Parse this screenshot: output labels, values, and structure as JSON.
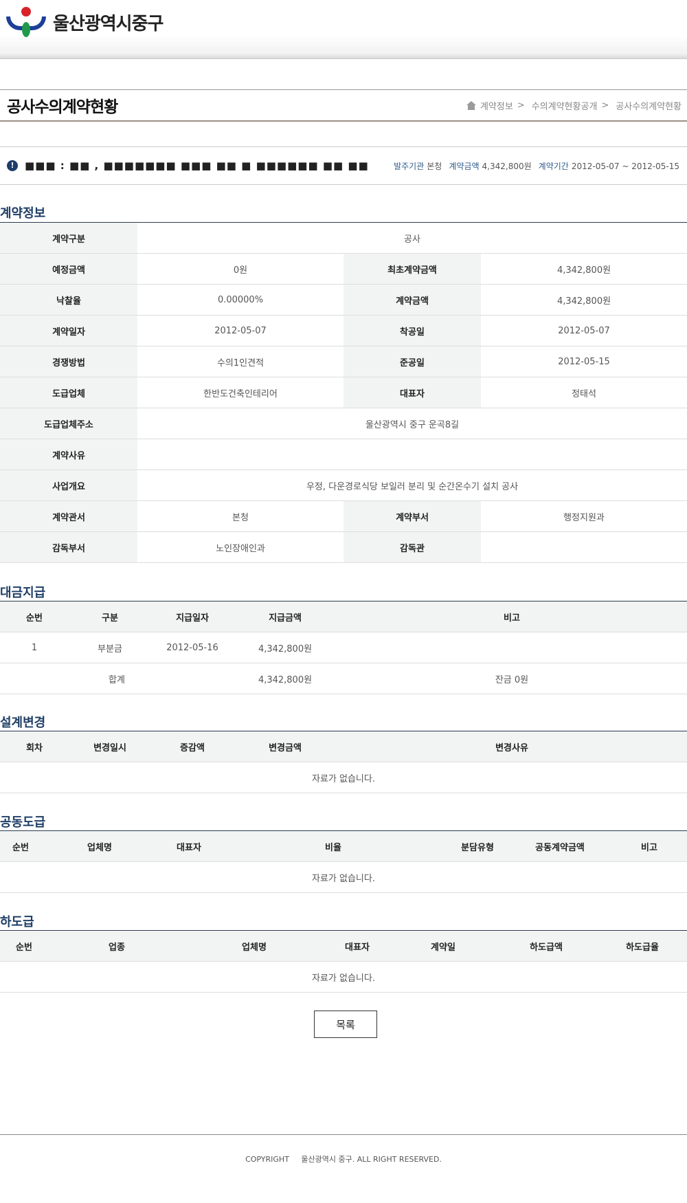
{
  "header": {
    "logo_text": "울산광역시중구"
  },
  "page": {
    "title": "공사수의계약현황",
    "breadcrumb": [
      "계약정보",
      "수의계약현황공개",
      "공사수의계약현황"
    ]
  },
  "summary": {
    "name": "■■■ : ■■ , ■■■■■■■ ■■■ ■■ ■ ■■■■■■ ■■ ■■",
    "agency_label": "발주기관",
    "agency": "본청",
    "amount_label": "계약금액",
    "amount": "4,342,800원",
    "period_label": "계약기간",
    "period": "2012-05-07 ~ 2012-05-15"
  },
  "contract": {
    "section_title": "계약정보",
    "type_label": "계약구분",
    "type": "공사",
    "estimate_label": "예정금액",
    "estimate": "0원",
    "initial_amount_label": "최초계약금액",
    "initial_amount": "4,342,800원",
    "rate_label": "낙찰율",
    "rate": "0.00000%",
    "amount_label": "계약금액",
    "amount": "4,342,800원",
    "date_label": "계약일자",
    "date": "2012-05-07",
    "start_label": "착공일",
    "start": "2012-05-07",
    "method_label": "경쟁방법",
    "method": "수의1인견적",
    "end_label": "준공일",
    "end": "2012-05-15",
    "company_label": "도급업체",
    "company": "한반도건축인테리어",
    "ceo_label": "대표자",
    "ceo": "정태석",
    "address_label": "도급업체주소",
    "address": "울산광역시 중구 운곡8길",
    "reason_label": "계약사유",
    "reason": "",
    "overview_label": "사업개요",
    "overview": "우정, 다운경로식당 보일러 분리 및 순간온수기 설치 공사",
    "office_label": "계약관서",
    "office": "본청",
    "dept_label": "계약부서",
    "dept": "행정지원과",
    "supervise_dept_label": "감독부서",
    "supervise_dept": "노인장애인과",
    "supervisor_label": "감독관",
    "supervisor": ""
  },
  "payment": {
    "section_title": "대금지급",
    "headers": [
      "순번",
      "구분",
      "지급일자",
      "지급금액",
      "비고"
    ],
    "rows": [
      {
        "no": "1",
        "kind": "부분금",
        "date": "2012-05-16",
        "amount": "4,342,800원",
        "note": ""
      }
    ],
    "total": {
      "label": "합계",
      "amount": "4,342,800원",
      "balance": "잔금 0원"
    }
  },
  "design_change": {
    "section_title": "설계변경",
    "headers": [
      "회차",
      "변경일시",
      "증감액",
      "변경금액",
      "변경사유"
    ],
    "empty": "자료가 없습니다."
  },
  "joint": {
    "section_title": "공동도급",
    "headers": [
      "순번",
      "업체명",
      "대표자",
      "비율",
      "분담유형",
      "공동계약금액",
      "비고"
    ],
    "empty": "자료가 없습니다."
  },
  "subcontract": {
    "section_title": "하도급",
    "headers": [
      "순번",
      "업종",
      "업체명",
      "대표자",
      "계약일",
      "하도급액",
      "하도급율"
    ],
    "empty": "자료가 없습니다."
  },
  "buttons": {
    "list": "목록"
  },
  "footer": {
    "copyright_label": "COPYRIGHT",
    "copyright_text": "울산광역시 중구. ALL RIGHT RESERVED."
  }
}
